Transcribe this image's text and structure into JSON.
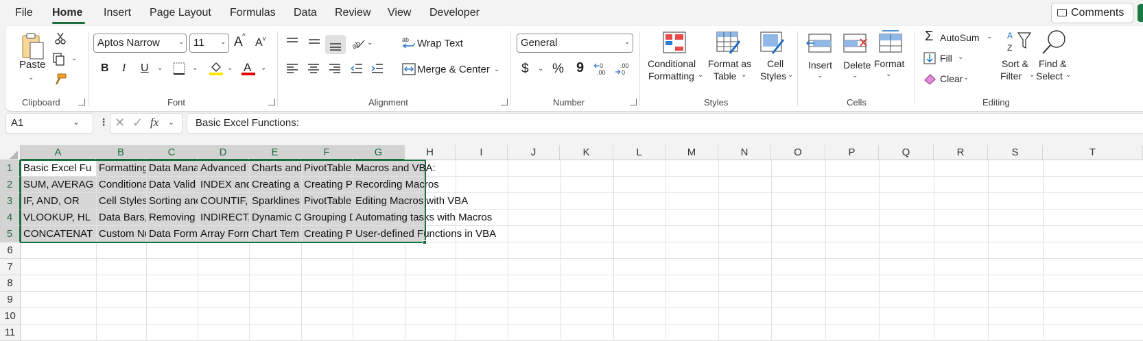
{
  "menu": {
    "file": "File",
    "home": "Home",
    "insert": "Insert",
    "page_layout": "Page Layout",
    "formulas": "Formulas",
    "data": "Data",
    "review": "Review",
    "view": "View",
    "developer": "Developer",
    "comments": "Comments"
  },
  "ribbon": {
    "clipboard": {
      "paste": "Paste",
      "group": "Clipboard"
    },
    "font": {
      "name": "Aptos Narrow",
      "size": "11",
      "group": "Font",
      "bold": "B",
      "italic": "I",
      "underline": "U",
      "grow": "A",
      "shrink": "A"
    },
    "alignment": {
      "wrap_text": "Wrap Text",
      "merge_center": "Merge & Center",
      "group": "Alignment"
    },
    "number": {
      "format": "General",
      "currency": "$",
      "percent": "%",
      "comma": "9",
      "group": "Number"
    },
    "styles": {
      "conditional_1": "Conditional",
      "conditional_2": "Formatting",
      "format_table_1": "Format as",
      "format_table_2": "Table",
      "cell_styles_1": "Cell",
      "cell_styles_2": "Styles",
      "group": "Styles"
    },
    "cells": {
      "insert": "Insert",
      "delete": "Delete",
      "format": "Format",
      "group": "Cells"
    },
    "editing": {
      "autosum": "AutoSum",
      "fill": "Fill",
      "clear": "Clear",
      "sort_1": "Sort &",
      "sort_2": "Filter",
      "find_1": "Find &",
      "find_2": "Select",
      "group": "Editing"
    },
    "colors": {
      "accent": "#1b6e3d",
      "highlight": "#ffe600",
      "font_color": "#e00000"
    }
  },
  "formula_bar": {
    "name_box": "A1",
    "fx": "fx",
    "content": "Basic Excel Functions:"
  },
  "grid": {
    "columns": [
      "A",
      "B",
      "C",
      "D",
      "E",
      "F",
      "G",
      "H",
      "I",
      "J",
      "K",
      "L",
      "M",
      "N",
      "O",
      "P",
      "Q",
      "R",
      "S",
      "T"
    ],
    "rows": [
      "1",
      "2",
      "3",
      "4",
      "5",
      "6",
      "7",
      "8",
      "9",
      "10",
      "11"
    ],
    "cells": [
      [
        "Basic Excel Fu",
        "Formatting",
        "Data Mana",
        "Advanced",
        "Charts and",
        "PivotTable",
        "Macros and VBA:"
      ],
      [
        "SUM, AVERAG",
        "Conditiona",
        "Data Valid",
        "INDEX and",
        "Creating a",
        "Creating P",
        "Recording Macros"
      ],
      [
        "IF, AND, OR",
        "Cell Styles",
        "Sorting and",
        "COUNTIF,",
        "Sparklines",
        "PivotTable",
        "Editing Macros with VBA"
      ],
      [
        "VLOOKUP, HL",
        "Data Bars,",
        "Removing",
        "INDIRECT,",
        "Dynamic C",
        "Grouping D",
        "Automating tasks with Macros"
      ],
      [
        "CONCATENAT",
        "Custom Nu",
        "Data Form",
        "Array Form",
        "Chart Tem",
        "Creating P",
        "User-defined Functions in VBA"
      ]
    ]
  }
}
